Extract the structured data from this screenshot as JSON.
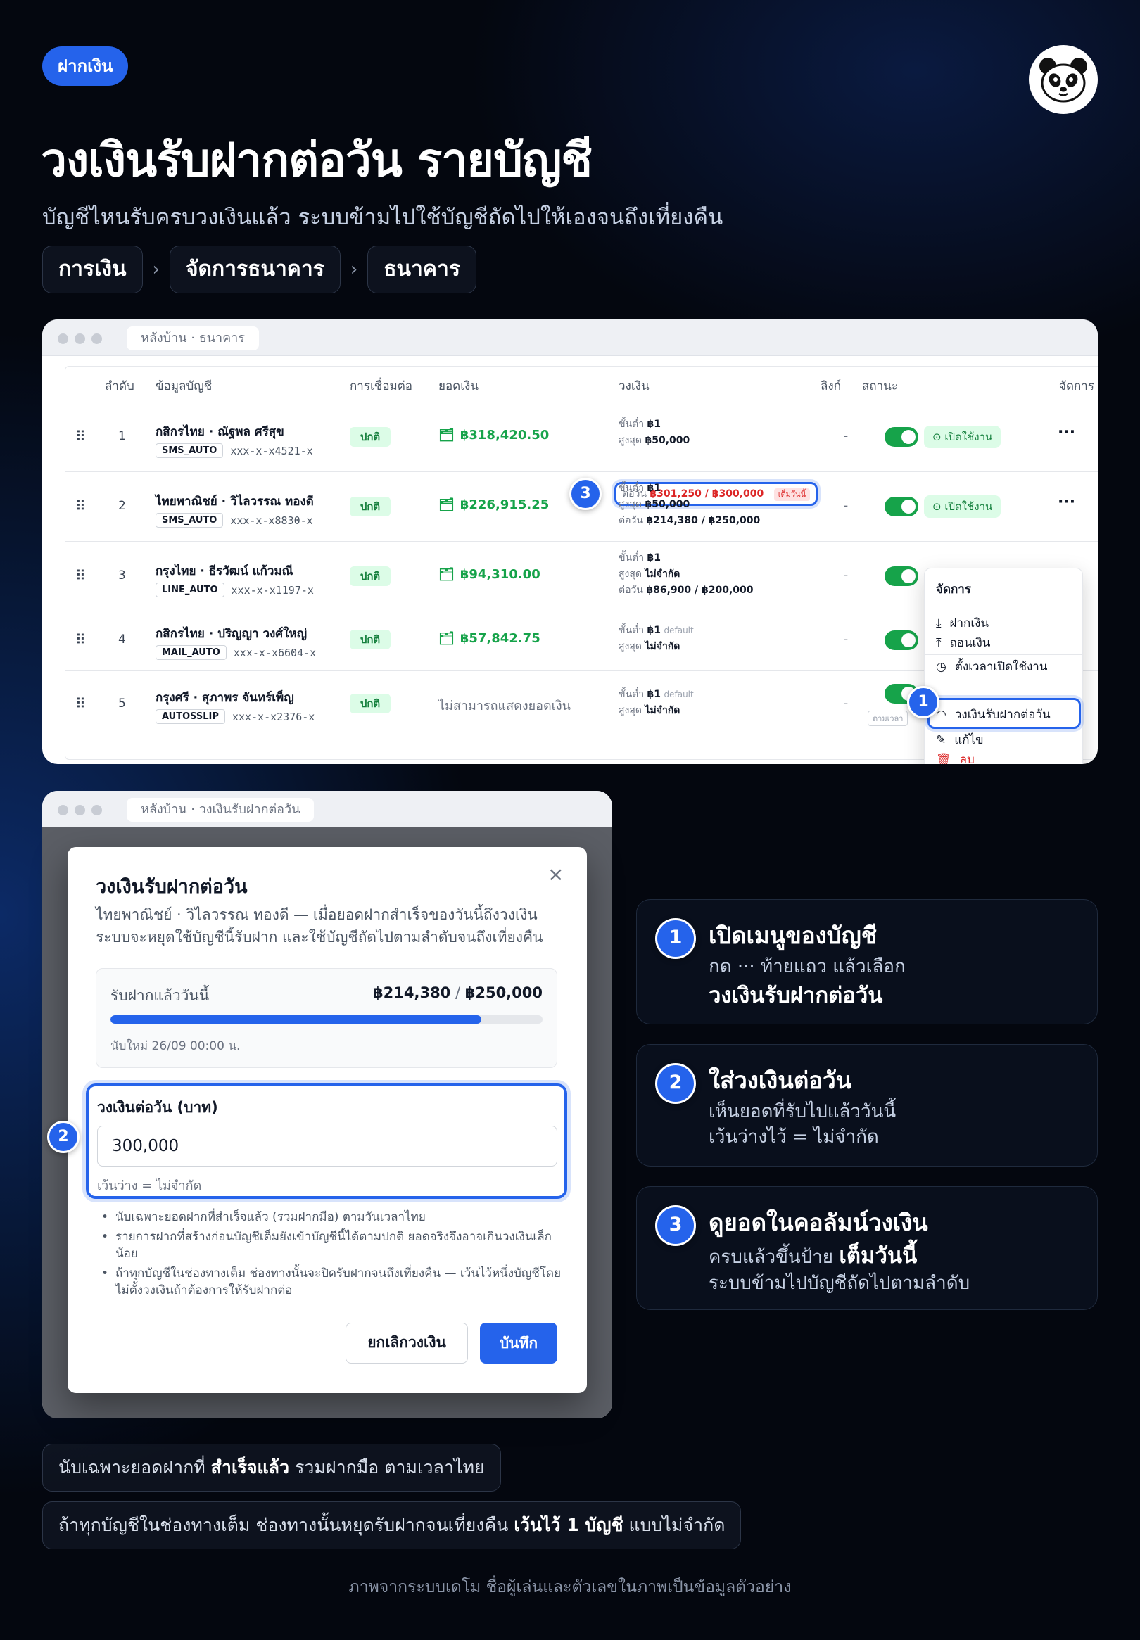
{
  "header": {
    "tag": "ฝากเงิน",
    "title": "วงเงินรับฝากต่อวัน รายบัญชี",
    "subtitle": "บัญชีไหนรับครบวงเงินแล้ว ระบบข้ามไปใช้บัญชีถัดไปให้เองจนถึงเที่ยงคืน",
    "breadcrumbs": [
      "การเงิน",
      "จัดการธนาคาร",
      "ธนาคาร"
    ],
    "breadcrumb_separator": "›",
    "logo_icon": "panda-icon"
  },
  "window1": {
    "url": "หลังบ้าน · ธนาคาร",
    "columns": [
      "ลำดับ",
      "ข้อมูลบัญชี",
      "การเชื่อมต่อ",
      "ยอดเงิน",
      "วงเงิน",
      "ลิงก์",
      "สถานะ",
      "จัดการ"
    ],
    "limit_labels": {
      "min": "ขั้นต่ำ",
      "max": "สูงสุด",
      "daily": "ต่อวัน",
      "default": "default"
    },
    "rows": [
      {
        "index": "1",
        "name": "กสิกรไทย · ณัฐพล ศรีสุข",
        "type": "SMS_AUTO",
        "account": "xxx-x-x4521-x",
        "conn": "ปกติ",
        "balance": "฿318,420.50",
        "min": "฿1",
        "max": "฿50,000",
        "daily": "฿301,250 / ฿300,000",
        "daily_badge": "เต็มวันนี้",
        "link": "-",
        "status": "เปิดใช้งาน",
        "more": "···"
      },
      {
        "index": "2",
        "name": "ไทยพาณิชย์ · วิไลวรรณ ทองดี",
        "type": "SMS_AUTO",
        "account": "xxx-x-x8830-x",
        "conn": "ปกติ",
        "balance": "฿226,915.25",
        "min": "฿1",
        "max": "฿50,000",
        "daily": "฿214,380 / ฿250,000",
        "link": "-",
        "status": "เปิดใช้งาน",
        "more": "···"
      },
      {
        "index": "3",
        "name": "กรุงไทย · ธีรวัฒน์ แก้วมณี",
        "type": "LINE_AUTO",
        "account": "xxx-x-x1197-x",
        "conn": "ปกติ",
        "balance": "฿94,310.00",
        "min": "฿1",
        "max": "ไม่จำกัด",
        "daily": "฿86,900 / ฿200,000",
        "link": "-"
      },
      {
        "index": "4",
        "name": "กสิกรไทย · ปริญญา วงศ์ใหญ่",
        "type": "MAIL_AUTO",
        "account": "xxx-x-x6604-x",
        "conn": "ปกติ",
        "balance": "฿57,842.75",
        "min": "฿1",
        "max": "ไม่จำกัด",
        "link": "-"
      },
      {
        "index": "5",
        "name": "กรุงศรี · สุภาพร จันทร์เพ็ญ",
        "type": "AUTOSSLIP",
        "account": "xxx-x-x2376-x",
        "conn": "ปกติ",
        "balance": "ไม่สามารถแสดงยอดเงิน",
        "min": "฿1",
        "max": "ไม่จำกัด",
        "link": "-",
        "status_small": "ตามเวลา"
      }
    ],
    "menu": {
      "title": "จัดการ",
      "items": [
        "ฝากเงิน",
        "ถอนเงิน",
        "ตั้งเวลาเปิดใช้งาน",
        "วงเงินรับฝากต่อวัน",
        "แก้ไข",
        "ลบ"
      ]
    }
  },
  "window2": {
    "url": "หลังบ้าน · วงเงินรับฝากต่อวัน",
    "modal": {
      "title": "วงเงินรับฝากต่อวัน",
      "close": "×",
      "description": "ไทยพาณิชย์ · วิไลวรรณ ทองดี — เมื่อยอดฝากสำเร็จของวันนี้ถึงวงเงิน ระบบจะหยุดใช้บัญชีนี้รับฝาก และใช้บัญชีถัดไปตามลำดับจนถึงเที่ยงคืน",
      "received_label": "รับฝากแล้ววันนี้",
      "received_value": "฿214,380",
      "received_sep": " / ",
      "received_limit": "฿250,000",
      "progress": 0.8575,
      "reset_text": "นับใหม่ 26/09 00:00 น.",
      "field_label": "วงเงินต่อวัน (บาท)",
      "field_value": "300,000",
      "field_hint": "เว้นว่าง = ไม่จำกัด",
      "notes": [
        "นับเฉพาะยอดฝากที่สำเร็จแล้ว (รวมฝากมือ) ตามวันเวลาไทย",
        "รายการฝากที่สร้างก่อนบัญชีเต็มยังเข้าบัญชีนี้ได้ตามปกติ ยอดจริงจึงอาจเกินวงเงินเล็กน้อย",
        "ถ้าทุกบัญชีในช่องทางเต็ม ช่องทางนั้นจะปิดรับฝากจนถึงเที่ยงคืน — เว้นไว้หนึ่งบัญชีโดยไม่ตั้งวงเงินถ้าต้องการให้รับฝากต่อ"
      ],
      "cancel": "ยกเลิกวงเงิน",
      "save": "บันทึก"
    }
  },
  "steps": [
    {
      "num": "1",
      "title": "เปิดเมนูของบัญชี",
      "line": "กด ··· ท้ายแถว แล้วเลือก",
      "bold": "วงเงินรับฝากต่อวัน"
    },
    {
      "num": "2",
      "title": "ใส่วงเงินต่อวัน",
      "line1": "เห็นยอดที่รับไปแล้ววันนี้",
      "line2": "เว้นว่างไว้ = ไม่จำกัด"
    },
    {
      "num": "3",
      "title": "ดูยอดในคอลัมน์วงเงิน",
      "line1_pre": "ครบแล้วขึ้นป้าย ",
      "line1_bold": "เต็มวันนี้",
      "line2": "ระบบข้ามไปบัญชีถัดไปตามลำดับ"
    }
  ],
  "notes": {
    "n1_pre": "นับเฉพาะยอดฝากที่ ",
    "n1_bold": "สำเร็จแล้ว",
    "n1_post": " รวมฝากมือ ตามเวลาไทย",
    "n2_pre": "ถ้าทุกบัญชีในช่องทางเต็ม ช่องทางนั้นหยุดรับฝากจนเที่ยงคืน ",
    "n2_bold": "เว้นไว้ 1 บัญชี",
    "n2_post": " แบบไม่จำกัด"
  },
  "footer": "ภาพจากระบบเดโม ชื่อผู้เล่นและตัวเลขในภาพเป็นข้อมูลตัวอย่าง",
  "colors": {
    "accent": "#2563eb",
    "success": "#16a34a",
    "danger": "#dc2626",
    "background": "#04070f"
  }
}
